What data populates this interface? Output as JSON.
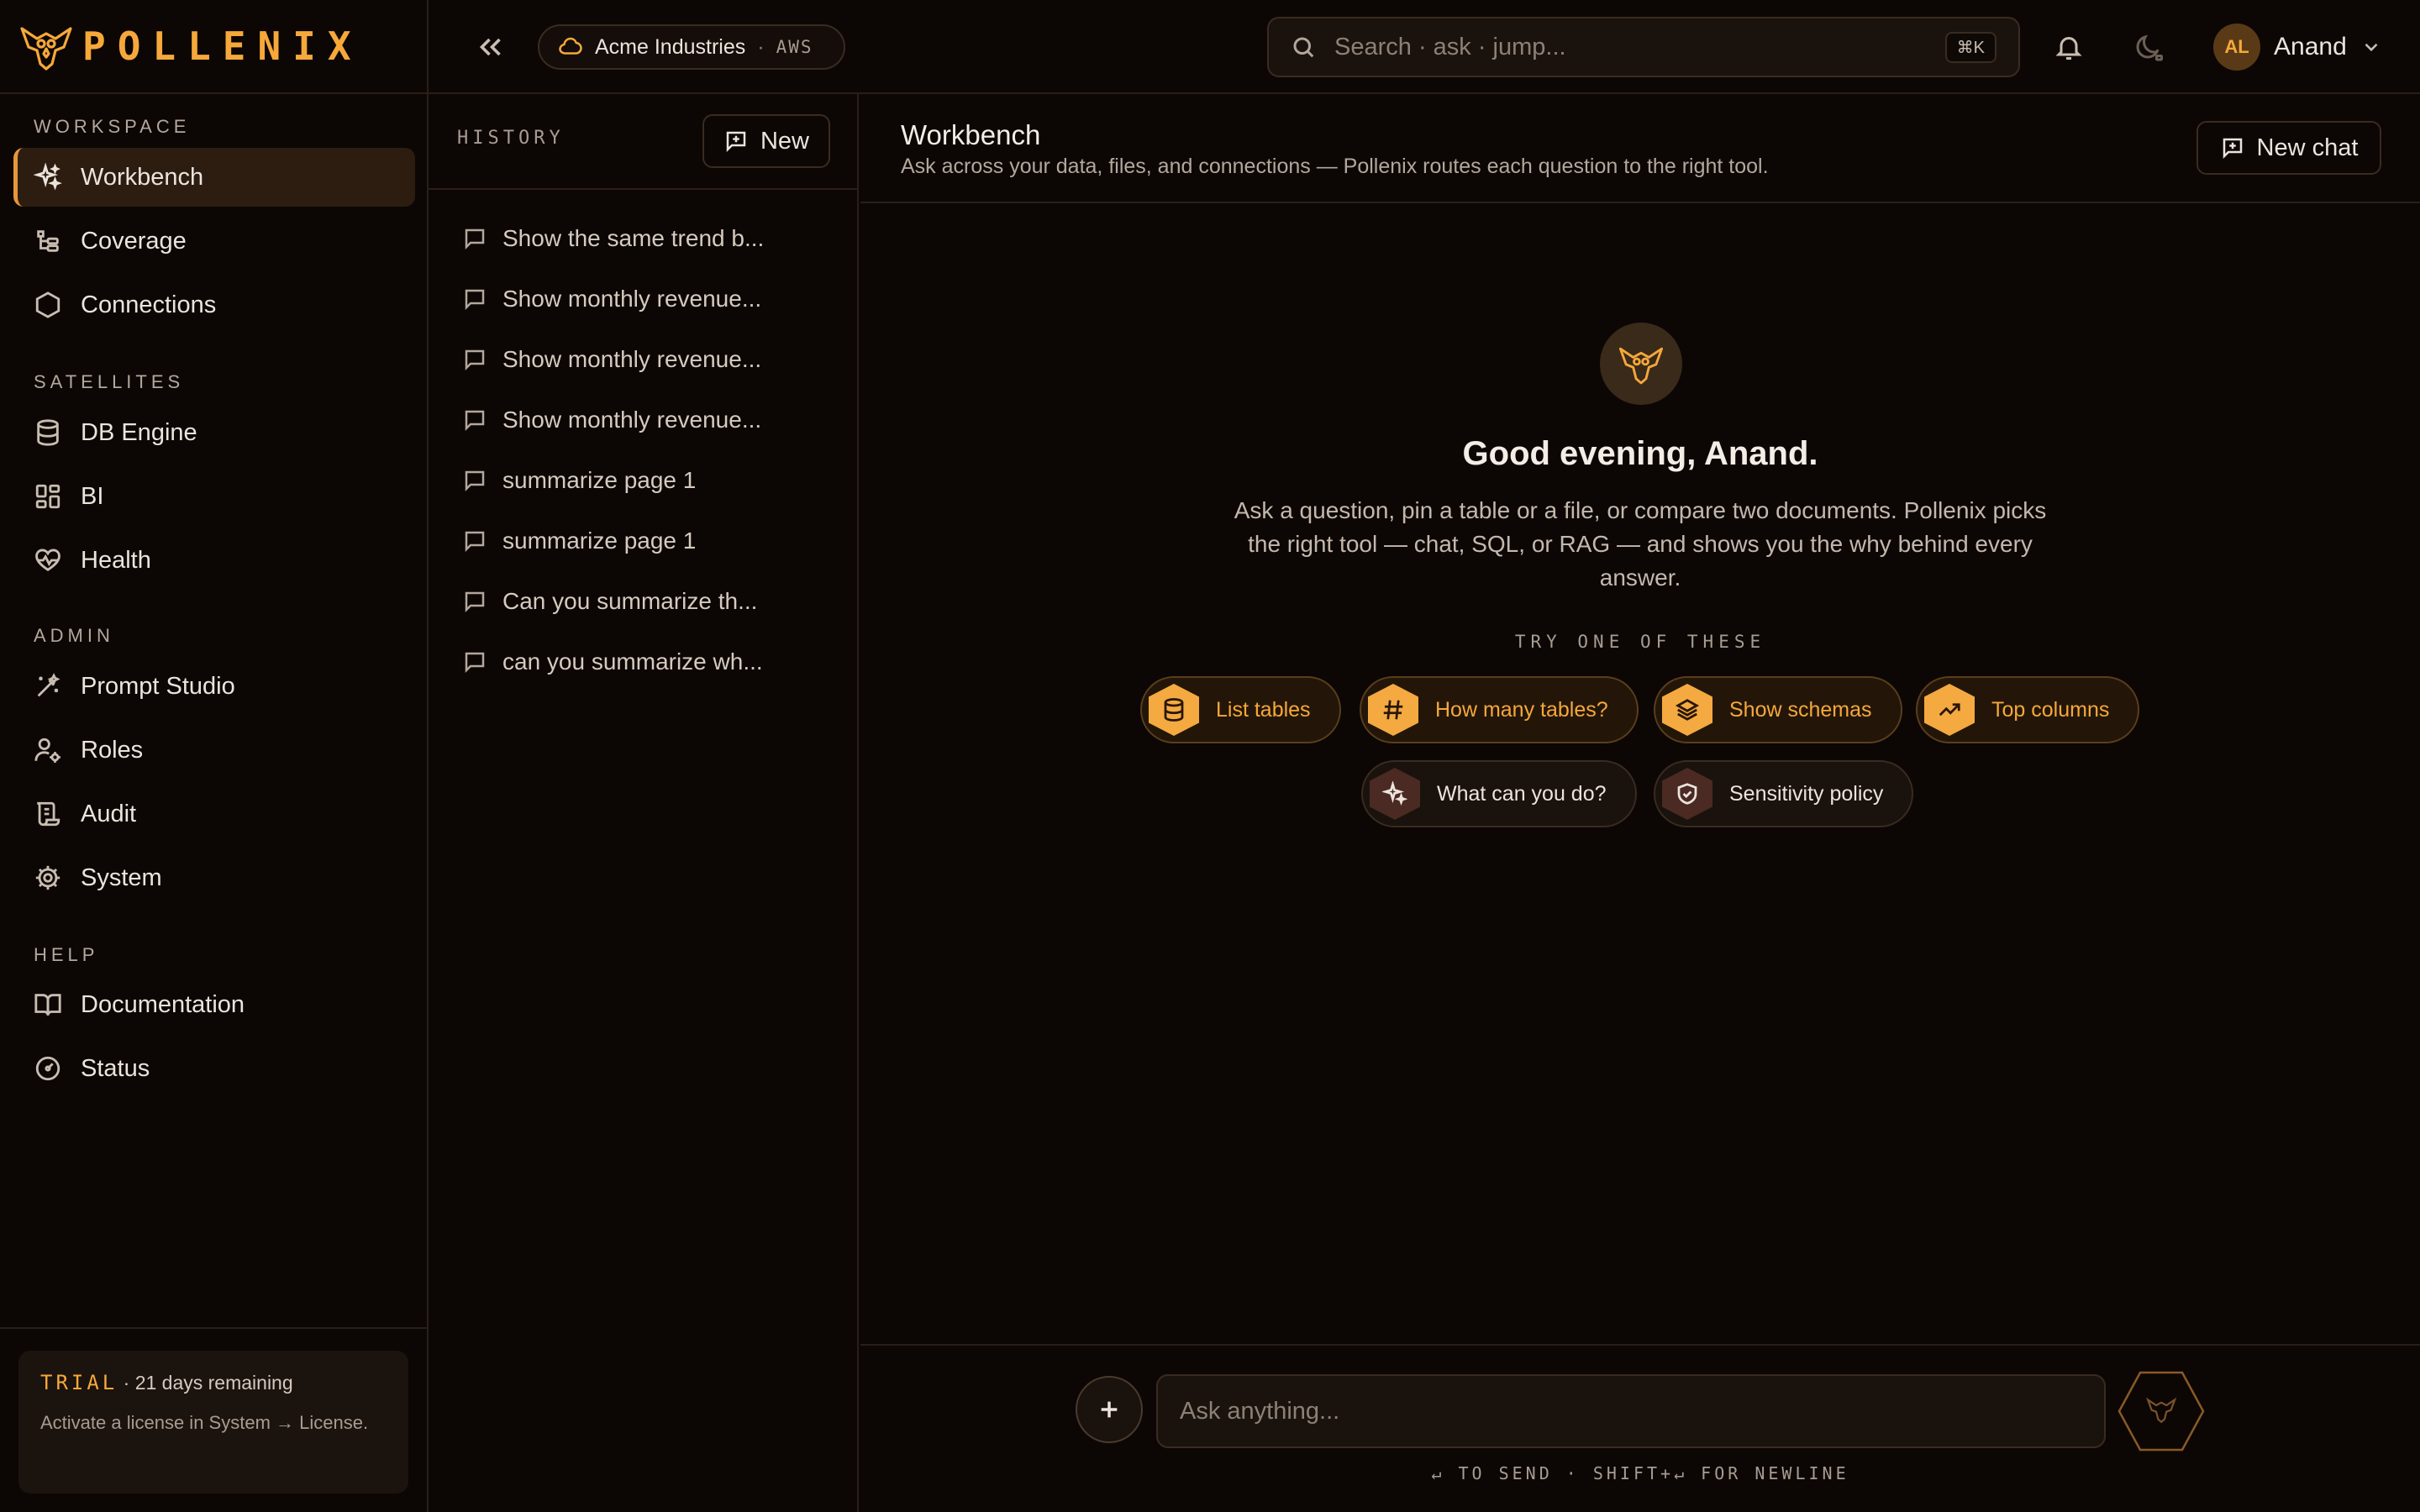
{
  "brand": {
    "name": "POLLENIX"
  },
  "sidebar": {
    "sections": [
      {
        "label": "WORKSPACE"
      },
      {
        "label": "SATELLITES"
      },
      {
        "label": "ADMIN"
      },
      {
        "label": "HELP"
      }
    ],
    "items": [
      {
        "label": "Workbench",
        "icon": "sparkles-icon",
        "active": true
      },
      {
        "label": "Coverage",
        "icon": "hierarchy-icon"
      },
      {
        "label": "Connections",
        "icon": "hexagon-icon"
      },
      {
        "label": "DB Engine",
        "icon": "database-icon"
      },
      {
        "label": "BI",
        "icon": "dashboard-icon"
      },
      {
        "label": "Health",
        "icon": "heart-pulse-icon"
      },
      {
        "label": "Prompt Studio",
        "icon": "wand-icon"
      },
      {
        "label": "Roles",
        "icon": "user-cog-icon"
      },
      {
        "label": "Audit",
        "icon": "scroll-icon"
      },
      {
        "label": "System",
        "icon": "gear-icon"
      },
      {
        "label": "Documentation",
        "icon": "book-icon"
      },
      {
        "label": "Status",
        "icon": "gauge-icon"
      }
    ],
    "trial": {
      "tag": "TRIAL",
      "remaining": " · 21 days remaining",
      "description": "Activate a license in System → License."
    }
  },
  "topbar": {
    "org": {
      "name": "Acme Industries",
      "separator": "·",
      "cloud": "AWS"
    },
    "search": {
      "placeholder": "Search · ask · jump...",
      "shortcut": "⌘K"
    },
    "user": {
      "initials": "AL",
      "name": "Anand"
    }
  },
  "history": {
    "label": "HISTORY",
    "new_label": "New",
    "items": [
      "Show the same trend b...",
      "Show monthly revenue...",
      "Show monthly revenue...",
      "Show monthly revenue...",
      "summarize page 1",
      "summarize page 1",
      "Can you summarize th...",
      "can you summarize wh..."
    ]
  },
  "main": {
    "title": "Workbench",
    "subtitle": "Ask across your data, files, and connections — Pollenix routes each question to the right tool.",
    "new_chat_label": "New chat",
    "greeting": "Good evening, Anand.",
    "intro": "Ask a question, pin a table or a file, or compare two documents. Pollenix picks the right tool — chat, SQL, or RAG — and shows you the why behind every answer.",
    "try_label": "TRY ONE OF THESE",
    "suggestions": [
      {
        "label": "List tables",
        "icon": "database-icon",
        "style": "primary"
      },
      {
        "label": "How many tables?",
        "icon": "hash-icon",
        "style": "primary"
      },
      {
        "label": "Show schemas",
        "icon": "layers-icon",
        "style": "primary"
      },
      {
        "label": "Top columns",
        "icon": "trending-up-icon",
        "style": "primary"
      },
      {
        "label": "What can you do?",
        "icon": "sparkles-icon",
        "style": "secondary"
      },
      {
        "label": "Sensitivity policy",
        "icon": "shield-icon",
        "style": "secondary"
      }
    ],
    "composer": {
      "placeholder": "Ask anything...",
      "hint": "↵ TO SEND · SHIFT+↵ FOR NEWLINE"
    }
  },
  "colors": {
    "accent": "#f6a83a",
    "background": "#0c0705",
    "border": "#2a1e17"
  }
}
